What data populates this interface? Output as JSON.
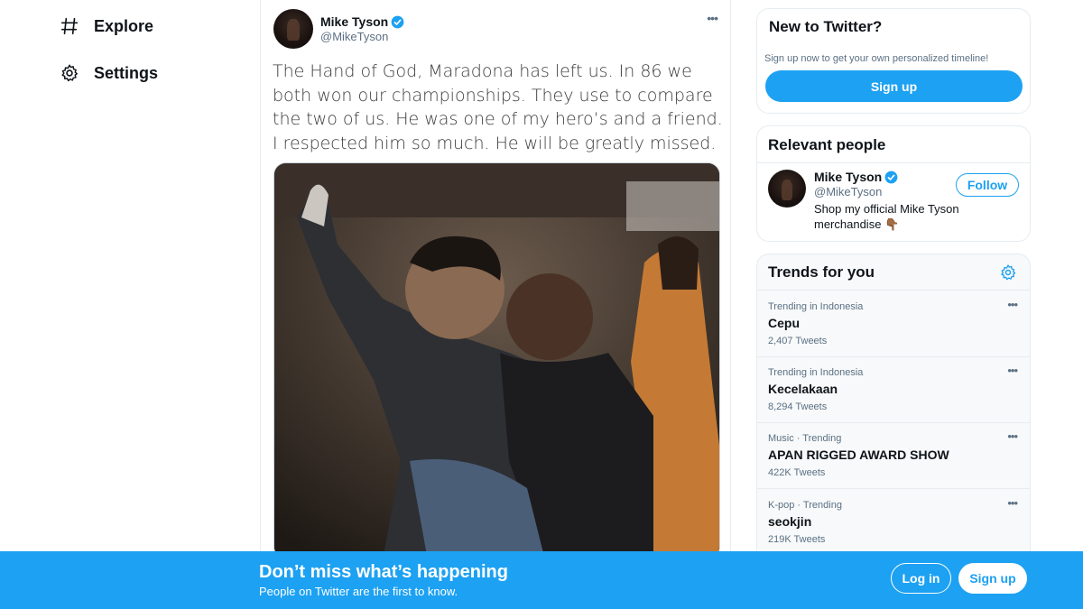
{
  "nav": {
    "explore": {
      "label": "Explore",
      "icon": "hashtag-icon"
    },
    "settings": {
      "label": "Settings",
      "icon": "gear-icon"
    }
  },
  "tweet": {
    "author_name": "Mike Tyson",
    "author_handle": "@MikeTyson",
    "verified": true,
    "more_label": "•••",
    "text": "The Hand of God, Maradona has left us.  In 86 we both won our championships.  They use to compare the two of us.  He was one of my hero’s and a friend.  I respected him so much.  He will be greatly missed."
  },
  "new_to_twitter": {
    "title": "New to Twitter?",
    "subtitle": "Sign up now to get your own personalized timeline!",
    "signup_label": "Sign up"
  },
  "relevant_people": {
    "title": "Relevant people",
    "person": {
      "name": "Mike Tyson",
      "handle": "@MikeTyson",
      "bio": "Shop my official Mike Tyson merchandise 👇🏾",
      "follow_label": "Follow"
    }
  },
  "trends": {
    "title": "Trends for you",
    "more_label": "•••",
    "items": [
      {
        "context": "Trending in Indonesia",
        "name": "Cepu",
        "count": "2,407 Tweets"
      },
      {
        "context": "Trending in Indonesia",
        "name": "Kecelakaan",
        "count": "8,294 Tweets"
      },
      {
        "context": "Music · Trending",
        "name": "APAN RIGGED AWARD SHOW",
        "count": "422K Tweets"
      },
      {
        "context": "K-pop · Trending",
        "name": "seokjin",
        "count": "219K Tweets"
      }
    ]
  },
  "banner": {
    "headline": "Don’t miss what’s happening",
    "subline": "People on Twitter are the first to know.",
    "login_label": "Log in",
    "signup_label": "Sign up"
  },
  "colors": {
    "accent": "#1da1f2",
    "text_secondary": "#5b7083",
    "border": "#e6ecf0"
  }
}
